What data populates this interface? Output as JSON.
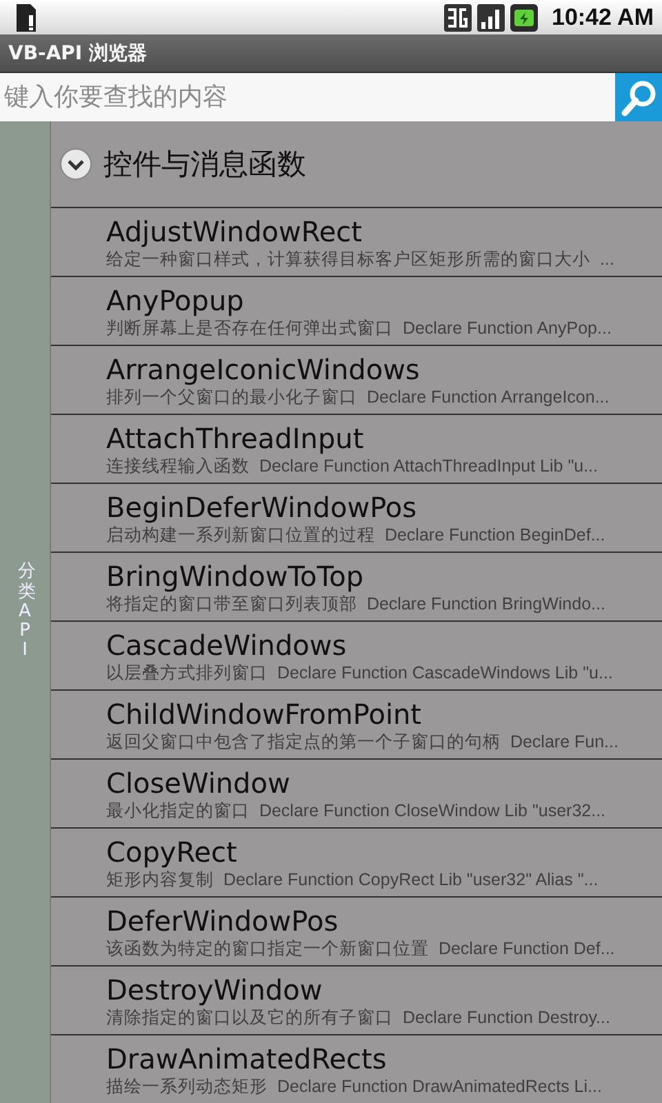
{
  "status_bar": {
    "time": "10:42 AM"
  },
  "window": {
    "title": "VB-API 浏览器"
  },
  "search": {
    "placeholder": "键入你要查找的内容"
  },
  "sidebar": {
    "label": "分类API"
  },
  "group": {
    "title": "控件与消息函数",
    "expanded": true,
    "items": [
      {
        "name": "AdjustWindowRect",
        "description": "给定一种窗口样式，计算获得目标客户区矩形所需的窗口大小  ..."
      },
      {
        "name": "AnyPopup",
        "description": "判断屏幕上是否存在任何弹出式窗口  Declare Function AnyPop..."
      },
      {
        "name": "ArrangeIconicWindows",
        "description": "排列一个父窗口的最小化子窗口  Declare Function ArrangeIcon..."
      },
      {
        "name": "AttachThreadInput",
        "description": "连接线程输入函数  Declare Function AttachThreadInput Lib \"u..."
      },
      {
        "name": "BeginDeferWindowPos",
        "description": "启动构建一系列新窗口位置的过程  Declare Function BeginDef..."
      },
      {
        "name": "BringWindowToTop",
        "description": "将指定的窗口带至窗口列表顶部  Declare Function BringWindo..."
      },
      {
        "name": "CascadeWindows",
        "description": "以层叠方式排列窗口  Declare Function CascadeWindows Lib \"u..."
      },
      {
        "name": "ChildWindowFromPoint",
        "description": "返回父窗口中包含了指定点的第一个子窗口的句柄  Declare Fun..."
      },
      {
        "name": "CloseWindow",
        "description": "最小化指定的窗口  Declare Function CloseWindow Lib \"user32..."
      },
      {
        "name": "CopyRect",
        "description": "矩形内容复制  Declare Function CopyRect Lib \"user32\" Alias \"..."
      },
      {
        "name": "DeferWindowPos",
        "description": "该函数为特定的窗口指定一个新窗口位置  Declare Function Def..."
      },
      {
        "name": "DestroyWindow",
        "description": "清除指定的窗口以及它的所有子窗口  Declare Function Destroy..."
      },
      {
        "name": "DrawAnimatedRects",
        "description": "描绘一系列动态矩形  Declare Function DrawAnimatedRects Li..."
      }
    ]
  }
}
